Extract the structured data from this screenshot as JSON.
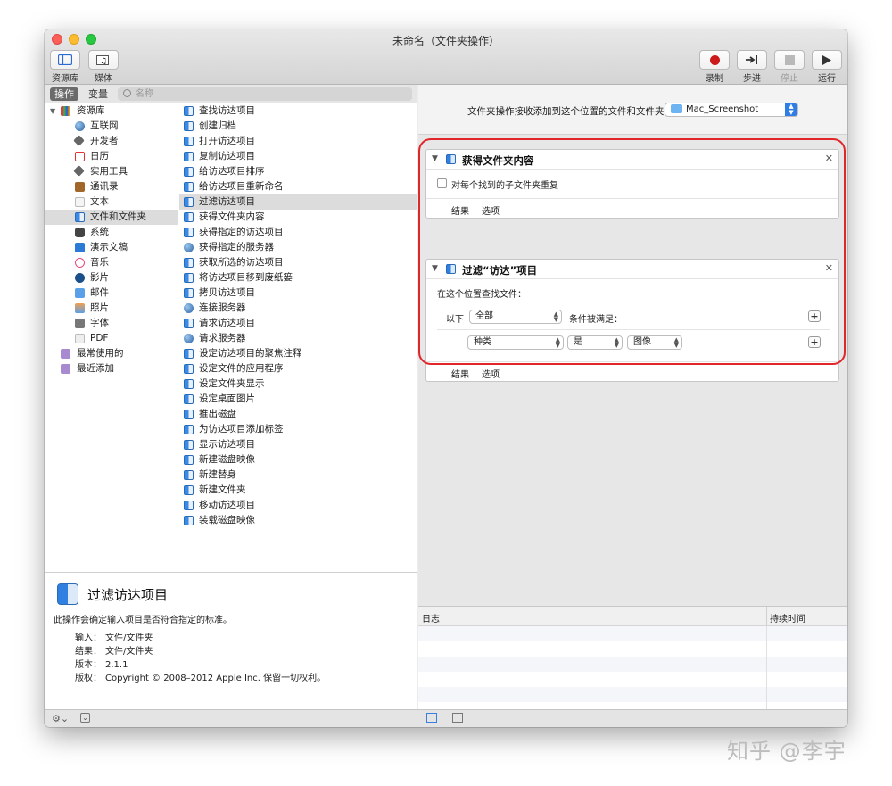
{
  "window": {
    "title": "未命名（文件夹操作）"
  },
  "toolbar": {
    "library_label": "资源库",
    "media_label": "媒体",
    "record_label": "录制",
    "step_label": "步进",
    "stop_label": "停止",
    "run_label": "运行"
  },
  "tabs": {
    "actions": "操作",
    "variables": "变量"
  },
  "search": {
    "placeholder": "名称"
  },
  "library": {
    "root": "资源库",
    "items": [
      {
        "label": "互联网",
        "icon": "globe"
      },
      {
        "label": "开发者",
        "icon": "tools"
      },
      {
        "label": "日历",
        "icon": "cal"
      },
      {
        "label": "实用工具",
        "icon": "tools"
      },
      {
        "label": "通讯录",
        "icon": "book"
      },
      {
        "label": "文本",
        "icon": "doc"
      },
      {
        "label": "文件和文件夹",
        "icon": "finder"
      },
      {
        "label": "系统",
        "icon": "sys"
      },
      {
        "label": "演示文稿",
        "icon": "present"
      },
      {
        "label": "音乐",
        "icon": "music"
      },
      {
        "label": "影片",
        "icon": "movie"
      },
      {
        "label": "邮件",
        "icon": "mail"
      },
      {
        "label": "照片",
        "icon": "photo"
      },
      {
        "label": "字体",
        "icon": "font"
      },
      {
        "label": "PDF",
        "icon": "pdf"
      }
    ],
    "smart": [
      "最常使用的",
      "最近添加"
    ]
  },
  "actions": [
    "查找访达项目",
    "创建归档",
    "打开访达项目",
    "复制访达项目",
    "给访达项目排序",
    "给访达项目重新命名",
    "过滤访达项目",
    "获得文件夹内容",
    "获得指定的访达项目",
    "获得指定的服务器",
    "获取所选的访达项目",
    "将访达项目移到废纸篓",
    "拷贝访达项目",
    "连接服务器",
    "请求访达项目",
    "请求服务器",
    "设定访达项目的聚焦注释",
    "设定文件的应用程序",
    "设定文件夹显示",
    "设定桌面图片",
    "推出磁盘",
    "为访达项目添加标签",
    "显示访达项目",
    "新建磁盘映像",
    "新建替身",
    "新建文件夹",
    "移动访达项目",
    "装载磁盘映像"
  ],
  "description": {
    "title": "过滤访达项目",
    "text": "此操作会确定输入项目是否符合指定的标准。",
    "input_key": "输入：",
    "input_val": "文件/文件夹",
    "result_key": "结果：",
    "result_val": "文件/文件夹",
    "version_key": "版本：",
    "version_val": "2.1.1",
    "copyright_key": "版权：",
    "copyright_val": "Copyright © 2008–2012 Apple Inc. 保留一切权利。"
  },
  "workflow": {
    "receive_label": "文件夹操作接收添加到这个位置的文件和文件夹",
    "folder": "Mac_Screenshot"
  },
  "action1": {
    "title": "获得文件夹内容",
    "checkbox_label": "对每个找到的子文件夹重复",
    "results": "结果",
    "options": "选项"
  },
  "action2": {
    "title": "过滤“访达”项目",
    "search_in": "在这个位置查找文件：",
    "if_label": "以下",
    "match": "全部",
    "conditions": "条件被满足：",
    "field": "种类",
    "op": "是",
    "value": "图像",
    "results": "结果",
    "options": "选项"
  },
  "log": {
    "col_log": "日志",
    "col_duration": "持续时间"
  },
  "watermark": "知乎 @李宇"
}
